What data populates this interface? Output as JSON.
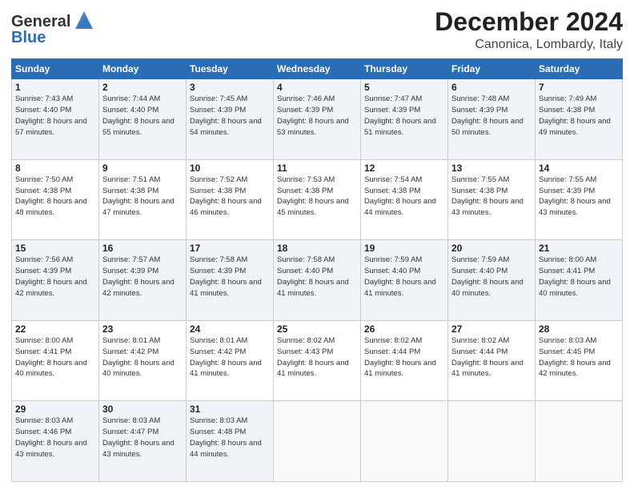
{
  "header": {
    "logo_line1": "General",
    "logo_line2": "Blue",
    "month": "December 2024",
    "location": "Canonica, Lombardy, Italy"
  },
  "days_of_week": [
    "Sunday",
    "Monday",
    "Tuesday",
    "Wednesday",
    "Thursday",
    "Friday",
    "Saturday"
  ],
  "weeks": [
    [
      {
        "day": "1",
        "sunrise": "7:43 AM",
        "sunset": "4:40 PM",
        "daylight": "8 hours and 57 minutes."
      },
      {
        "day": "2",
        "sunrise": "7:44 AM",
        "sunset": "4:40 PM",
        "daylight": "8 hours and 55 minutes."
      },
      {
        "day": "3",
        "sunrise": "7:45 AM",
        "sunset": "4:39 PM",
        "daylight": "8 hours and 54 minutes."
      },
      {
        "day": "4",
        "sunrise": "7:46 AM",
        "sunset": "4:39 PM",
        "daylight": "8 hours and 53 minutes."
      },
      {
        "day": "5",
        "sunrise": "7:47 AM",
        "sunset": "4:39 PM",
        "daylight": "8 hours and 51 minutes."
      },
      {
        "day": "6",
        "sunrise": "7:48 AM",
        "sunset": "4:39 PM",
        "daylight": "8 hours and 50 minutes."
      },
      {
        "day": "7",
        "sunrise": "7:49 AM",
        "sunset": "4:38 PM",
        "daylight": "8 hours and 49 minutes."
      }
    ],
    [
      {
        "day": "8",
        "sunrise": "7:50 AM",
        "sunset": "4:38 PM",
        "daylight": "8 hours and 48 minutes."
      },
      {
        "day": "9",
        "sunrise": "7:51 AM",
        "sunset": "4:38 PM",
        "daylight": "8 hours and 47 minutes."
      },
      {
        "day": "10",
        "sunrise": "7:52 AM",
        "sunset": "4:38 PM",
        "daylight": "8 hours and 46 minutes."
      },
      {
        "day": "11",
        "sunrise": "7:53 AM",
        "sunset": "4:38 PM",
        "daylight": "8 hours and 45 minutes."
      },
      {
        "day": "12",
        "sunrise": "7:54 AM",
        "sunset": "4:38 PM",
        "daylight": "8 hours and 44 minutes."
      },
      {
        "day": "13",
        "sunrise": "7:55 AM",
        "sunset": "4:38 PM",
        "daylight": "8 hours and 43 minutes."
      },
      {
        "day": "14",
        "sunrise": "7:55 AM",
        "sunset": "4:39 PM",
        "daylight": "8 hours and 43 minutes."
      }
    ],
    [
      {
        "day": "15",
        "sunrise": "7:56 AM",
        "sunset": "4:39 PM",
        "daylight": "8 hours and 42 minutes."
      },
      {
        "day": "16",
        "sunrise": "7:57 AM",
        "sunset": "4:39 PM",
        "daylight": "8 hours and 42 minutes."
      },
      {
        "day": "17",
        "sunrise": "7:58 AM",
        "sunset": "4:39 PM",
        "daylight": "8 hours and 41 minutes."
      },
      {
        "day": "18",
        "sunrise": "7:58 AM",
        "sunset": "4:40 PM",
        "daylight": "8 hours and 41 minutes."
      },
      {
        "day": "19",
        "sunrise": "7:59 AM",
        "sunset": "4:40 PM",
        "daylight": "8 hours and 41 minutes."
      },
      {
        "day": "20",
        "sunrise": "7:59 AM",
        "sunset": "4:40 PM",
        "daylight": "8 hours and 40 minutes."
      },
      {
        "day": "21",
        "sunrise": "8:00 AM",
        "sunset": "4:41 PM",
        "daylight": "8 hours and 40 minutes."
      }
    ],
    [
      {
        "day": "22",
        "sunrise": "8:00 AM",
        "sunset": "4:41 PM",
        "daylight": "8 hours and 40 minutes."
      },
      {
        "day": "23",
        "sunrise": "8:01 AM",
        "sunset": "4:42 PM",
        "daylight": "8 hours and 40 minutes."
      },
      {
        "day": "24",
        "sunrise": "8:01 AM",
        "sunset": "4:42 PM",
        "daylight": "8 hours and 41 minutes."
      },
      {
        "day": "25",
        "sunrise": "8:02 AM",
        "sunset": "4:43 PM",
        "daylight": "8 hours and 41 minutes."
      },
      {
        "day": "26",
        "sunrise": "8:02 AM",
        "sunset": "4:44 PM",
        "daylight": "8 hours and 41 minutes."
      },
      {
        "day": "27",
        "sunrise": "8:02 AM",
        "sunset": "4:44 PM",
        "daylight": "8 hours and 41 minutes."
      },
      {
        "day": "28",
        "sunrise": "8:03 AM",
        "sunset": "4:45 PM",
        "daylight": "8 hours and 42 minutes."
      }
    ],
    [
      {
        "day": "29",
        "sunrise": "8:03 AM",
        "sunset": "4:46 PM",
        "daylight": "8 hours and 43 minutes."
      },
      {
        "day": "30",
        "sunrise": "8:03 AM",
        "sunset": "4:47 PM",
        "daylight": "8 hours and 43 minutes."
      },
      {
        "day": "31",
        "sunrise": "8:03 AM",
        "sunset": "4:48 PM",
        "daylight": "8 hours and 44 minutes."
      },
      null,
      null,
      null,
      null
    ]
  ]
}
